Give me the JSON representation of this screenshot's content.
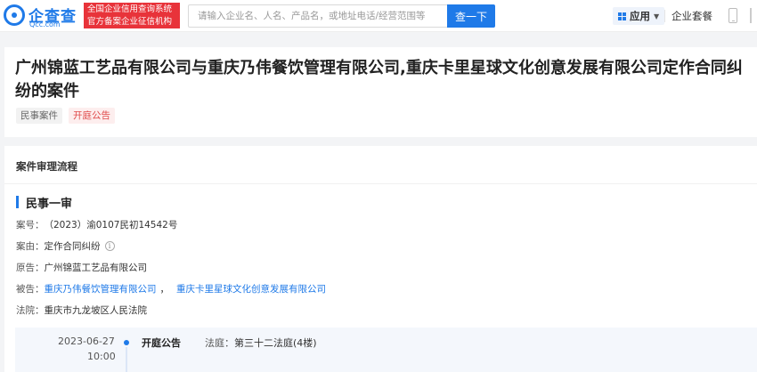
{
  "header": {
    "logo_name": "企查查",
    "logo_sub": "Qcc.com",
    "badge_line1": "全国企业信用查询系统",
    "badge_line2": "官方备案企业征信机构",
    "search_placeholder": "请输入企业名、人名、产品名，或地址电话/经营范围等",
    "search_button": "查一下",
    "apps_label": "应用",
    "plan_label": "企业套餐"
  },
  "case": {
    "title": "广州锦蓝工艺品有限公司与重庆乃伟餐饮管理有限公司,重庆卡里星球文化创意发展有限公司定作合同纠纷的案件",
    "tags": [
      "民事案件",
      "开庭公告"
    ]
  },
  "flow": {
    "section_title": "案件审理流程",
    "stage_title": "民事一审",
    "fields": {
      "case_no_label": "案号：",
      "case_no": "（2023）渝0107民初14542号",
      "cause_label": "案由：",
      "cause": "定作合同纠纷",
      "plaintiff_label": "原告：",
      "plaintiff": "广州锦蓝工艺品有限公司",
      "defendant_label": "被告：",
      "defendants": [
        "重庆乃伟餐饮管理有限公司",
        "重庆卡里星球文化创意发展有限公司"
      ],
      "defendant_sep": "，",
      "court_label": "法院：",
      "court": "重庆市九龙坡区人民法院"
    },
    "timeline": [
      {
        "date": "2023-06-27",
        "time": "10:00",
        "event": "开庭公告",
        "detail_label": "法庭：",
        "detail": "第三十二法庭(4楼)"
      }
    ]
  },
  "colors": {
    "brand": "#1f7ae8",
    "badge_red": "#e8333a",
    "tag_red_text": "#e04b4b"
  },
  "icons": [
    "qcc-logo-icon",
    "apps-grid-icon",
    "chevron-down-icon",
    "info-icon",
    "phone-icon"
  ]
}
